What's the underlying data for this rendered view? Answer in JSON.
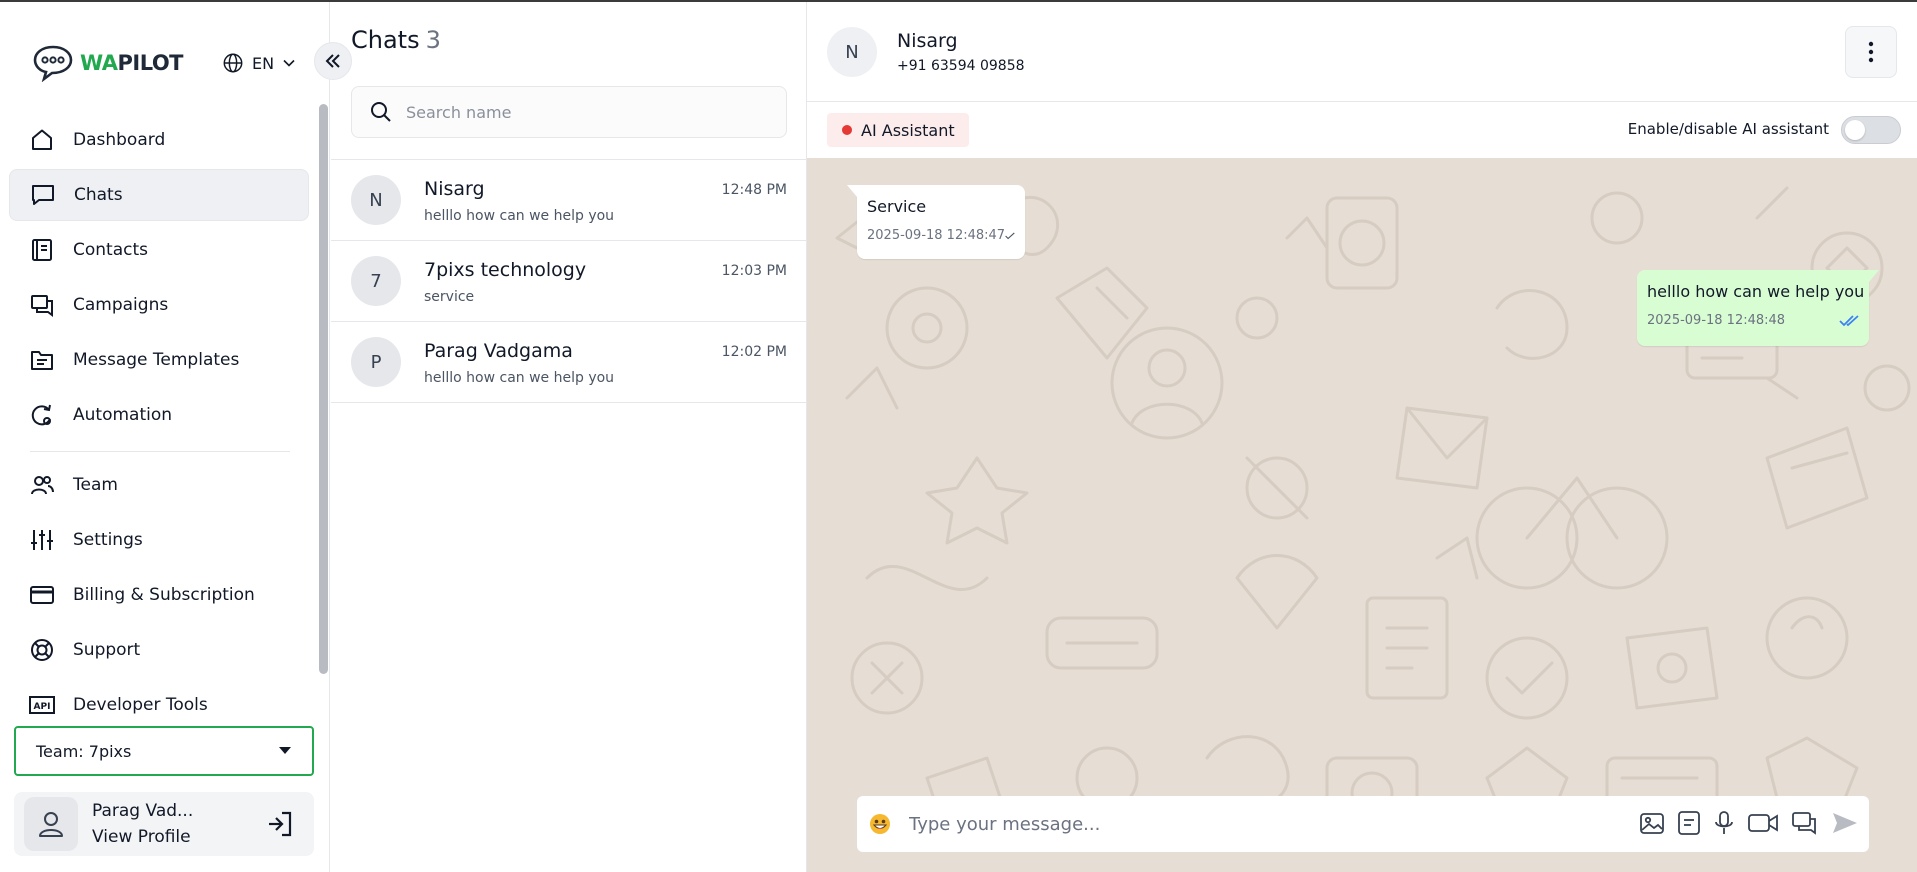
{
  "brand": {
    "wa": "WA",
    "pilot": "PILOT"
  },
  "language": {
    "code": "EN"
  },
  "nav": {
    "items": [
      {
        "label": "Dashboard",
        "icon": "home-icon"
      },
      {
        "label": "Chats",
        "icon": "chat-bubble-icon",
        "active": true
      },
      {
        "label": "Contacts",
        "icon": "contacts-book-icon"
      },
      {
        "label": "Campaigns",
        "icon": "campaigns-icon"
      },
      {
        "label": "Message Templates",
        "icon": "template-folder-icon"
      },
      {
        "label": "Automation",
        "icon": "automation-gear-icon"
      },
      {
        "label": "Team",
        "icon": "team-icon"
      },
      {
        "label": "Settings",
        "icon": "sliders-icon"
      },
      {
        "label": "Billing & Subscription",
        "icon": "credit-card-icon"
      },
      {
        "label": "Support",
        "icon": "lifebuoy-icon"
      },
      {
        "label": "Developer Tools",
        "icon": "api-icon"
      }
    ]
  },
  "team": {
    "selected": "Team: 7pixs"
  },
  "profile": {
    "name": "Parag Vad...",
    "link": "View Profile"
  },
  "chat_list": {
    "title": "Chats",
    "count": "3",
    "search_placeholder": "Search name",
    "items": [
      {
        "initial": "N",
        "name": "Nisarg",
        "last_message": "helllo how can we help you",
        "time": "12:48 PM"
      },
      {
        "initial": "7",
        "name": "7pixs technology",
        "last_message": "service",
        "time": "12:03 PM"
      },
      {
        "initial": "P",
        "name": "Parag Vadgama",
        "last_message": "helllo how can we help you",
        "time": "12:02 PM"
      }
    ]
  },
  "conversation": {
    "contact_initial": "N",
    "contact_name": "Nisarg",
    "contact_phone": "+91 63594 09858",
    "ai_badge": "AI Assistant",
    "ai_toggle_label": "Enable/disable AI assistant",
    "ai_enabled": false,
    "messages": [
      {
        "direction": "incoming",
        "text": "Service",
        "timestamp": "2025-09-18 12:48:47",
        "status": "sent"
      },
      {
        "direction": "outgoing",
        "text": "helllo how can we help you",
        "timestamp": "2025-09-18 12:48:48",
        "status": "read"
      }
    ],
    "composer_placeholder": "Type your message..."
  },
  "colors": {
    "brand_green": "#22a94f",
    "chat_bg": "#e6ddd4",
    "outgoing_bubble": "#d9fdd3",
    "ai_dot": "#e53935",
    "read_tick": "#3b82f6"
  }
}
